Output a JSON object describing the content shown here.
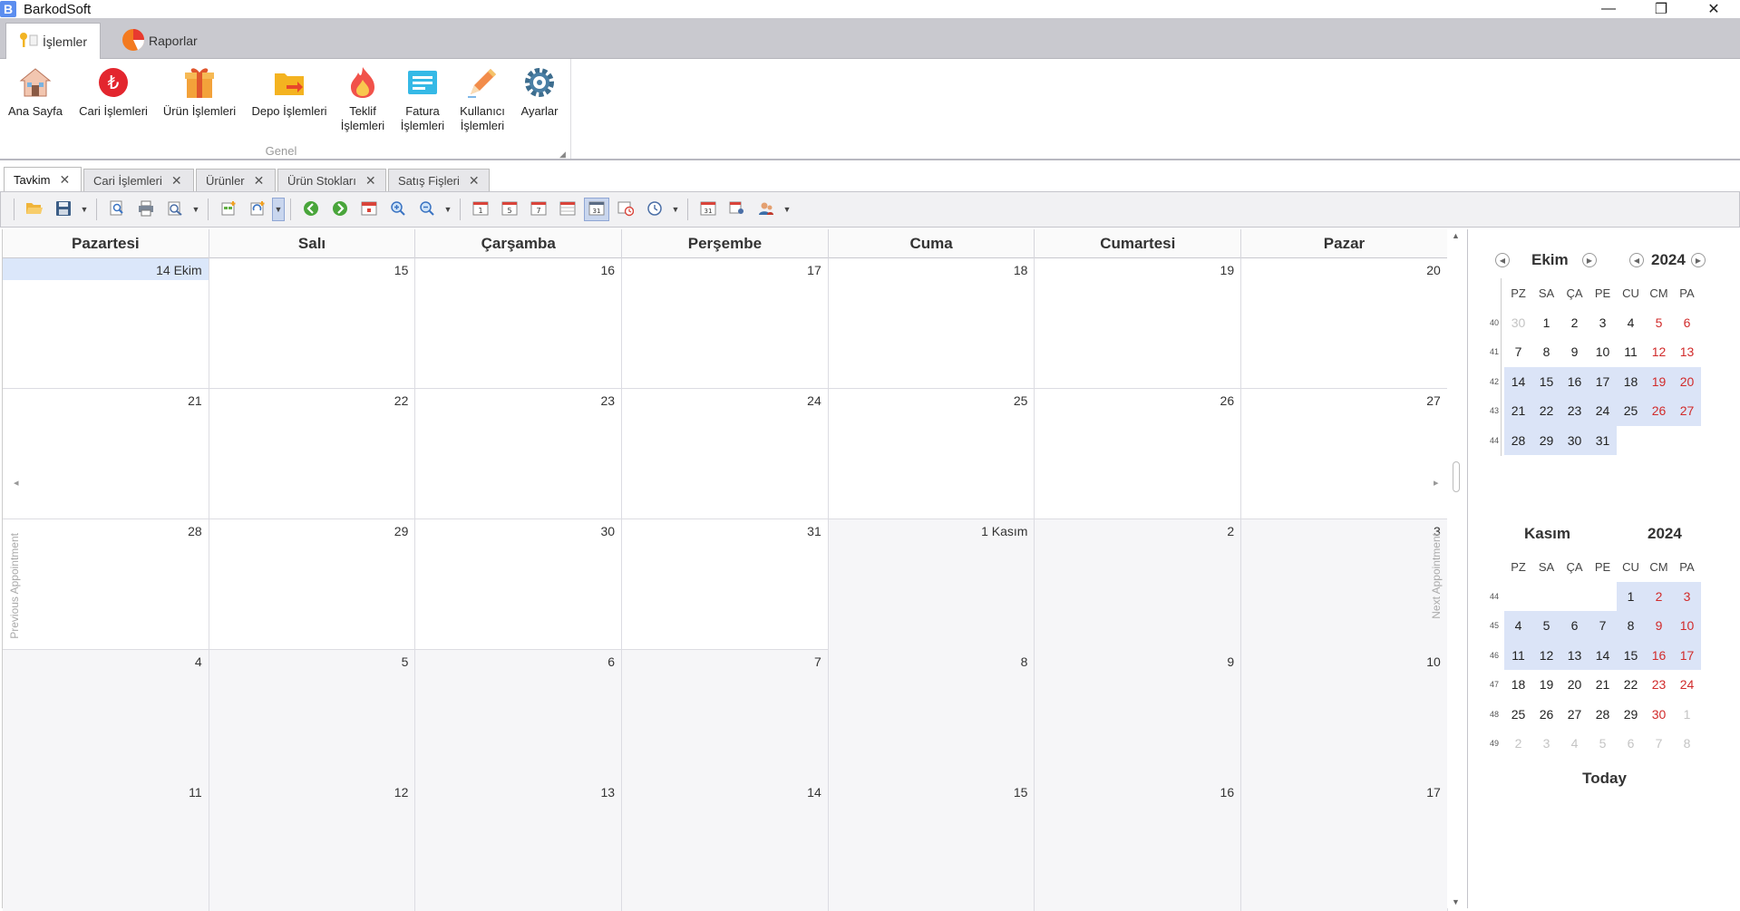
{
  "app": {
    "title": "BarkodSoft",
    "logo": "B",
    "win_min": "—",
    "win_restore": "❐",
    "win_close": "✕"
  },
  "ribbon_tabs": [
    {
      "label": "İşlemler"
    },
    {
      "label": "Raporlar"
    }
  ],
  "ribbon": {
    "group_label": "Genel",
    "buttons": [
      {
        "label": "Ana Sayfa",
        "icon": "home-icon"
      },
      {
        "label": "Cari İşlemleri",
        "icon": "lira-icon"
      },
      {
        "label": "Ürün İşlemleri",
        "icon": "gift-box-icon"
      },
      {
        "label": "Depo İşlemleri",
        "icon": "warehouse-folder-icon"
      },
      {
        "label": "Teklif\nİşlemleri",
        "icon": "fire-icon"
      },
      {
        "label": "Fatura\nİşlemleri",
        "icon": "invoice-icon"
      },
      {
        "label": "Kullanıcı\nİşlemleri",
        "icon": "pencil-icon"
      },
      {
        "label": "Ayarlar",
        "icon": "gear-icon"
      }
    ]
  },
  "doc_tabs": [
    {
      "label": "Tavkim",
      "active": true
    },
    {
      "label": "Cari İşlemleri"
    },
    {
      "label": "Ürünler"
    },
    {
      "label": "Ürün Stokları"
    },
    {
      "label": "Satış Fişleri"
    }
  ],
  "calendar": {
    "days": [
      "Pazartesi",
      "Salı",
      "Çarşamba",
      "Perşembe",
      "Cuma",
      "Cumartesi",
      "Pazar"
    ],
    "weeks": [
      [
        "14 Ekim",
        "15",
        "16",
        "17",
        "18",
        "19",
        "20"
      ],
      [
        "21",
        "22",
        "23",
        "24",
        "25",
        "26",
        "27"
      ],
      [
        "28",
        "29",
        "30",
        "31",
        "1 Kasım",
        "2",
        "3"
      ],
      [
        "4",
        "5",
        "6",
        "7",
        "8",
        "9",
        "10"
      ],
      [
        "11",
        "12",
        "13",
        "14",
        "15",
        "16",
        "17"
      ]
    ],
    "prev_label": "Previous Appointment",
    "next_label": "Next Appointment"
  },
  "mini_calendars": [
    {
      "month": "Ekim",
      "year": "2024",
      "headers": [
        "PZ",
        "SA",
        "ÇA",
        "PE",
        "CU",
        "CM",
        "PA"
      ],
      "weeks": [
        {
          "wk": "40",
          "days": [
            "30",
            "1",
            "2",
            "3",
            "4",
            "5",
            "6"
          ]
        },
        {
          "wk": "41",
          "days": [
            "7",
            "8",
            "9",
            "10",
            "11",
            "12",
            "13"
          ]
        },
        {
          "wk": "42",
          "days": [
            "14",
            "15",
            "16",
            "17",
            "18",
            "19",
            "20"
          ]
        },
        {
          "wk": "43",
          "days": [
            "21",
            "22",
            "23",
            "24",
            "25",
            "26",
            "27"
          ]
        },
        {
          "wk": "44",
          "days": [
            "28",
            "29",
            "30",
            "31",
            "",
            "",
            ""
          ]
        }
      ]
    },
    {
      "month": "Kasım",
      "year": "2024",
      "headers": [
        "PZ",
        "SA",
        "ÇA",
        "PE",
        "CU",
        "CM",
        "PA"
      ],
      "weeks": [
        {
          "wk": "44",
          "days": [
            "",
            "",
            "",
            "",
            "1",
            "2",
            "3"
          ]
        },
        {
          "wk": "45",
          "days": [
            "4",
            "5",
            "6",
            "7",
            "8",
            "9",
            "10"
          ]
        },
        {
          "wk": "46",
          "days": [
            "11",
            "12",
            "13",
            "14",
            "15",
            "16",
            "17"
          ]
        },
        {
          "wk": "47",
          "days": [
            "18",
            "19",
            "20",
            "21",
            "22",
            "23",
            "24"
          ]
        },
        {
          "wk": "48",
          "days": [
            "25",
            "26",
            "27",
            "28",
            "29",
            "30",
            "1"
          ]
        },
        {
          "wk": "49",
          "days": [
            "2",
            "3",
            "4",
            "5",
            "6",
            "7",
            "8"
          ]
        }
      ]
    }
  ],
  "today_label": "Today",
  "colors": {
    "selection": "#dbe4f7",
    "weekend": "#d12b2b",
    "accent": "#5b8def"
  }
}
